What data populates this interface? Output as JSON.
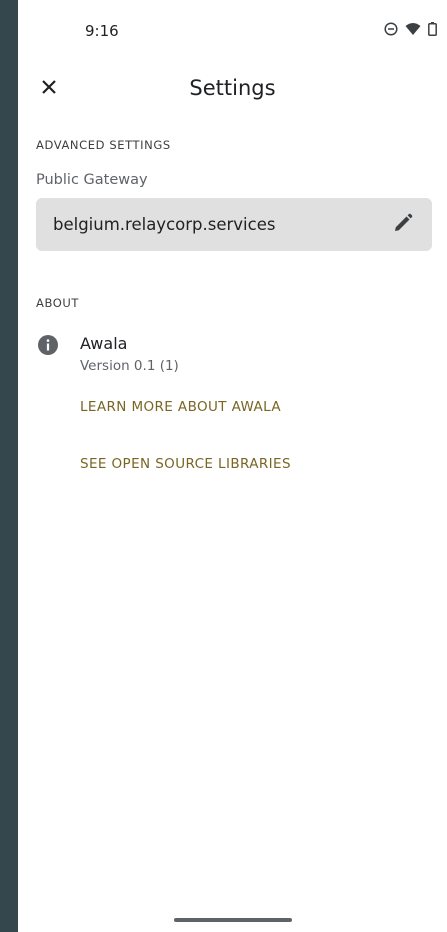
{
  "status_bar": {
    "time": "9:16",
    "icons": [
      "do-not-disturb-icon",
      "wifi-icon",
      "battery-icon"
    ]
  },
  "toolbar": {
    "close_icon": "close-icon",
    "title": "Settings"
  },
  "advanced": {
    "header": "ADVANCED SETTINGS",
    "public_gateway_label": "Public Gateway",
    "public_gateway_value": "belgium.relaycorp.services",
    "edit_icon": "pencil-icon"
  },
  "about": {
    "header": "ABOUT",
    "info_icon": "info-icon",
    "app_name": "Awala",
    "version": "Version 0.1 (1)",
    "learn_more": "LEARN MORE ABOUT AWALA",
    "open_source": "SEE OPEN SOURCE LIBRARIES"
  },
  "colors": {
    "background_strip": "#34474d",
    "link": "#7a6524",
    "field_bg": "#e0e0e0"
  }
}
